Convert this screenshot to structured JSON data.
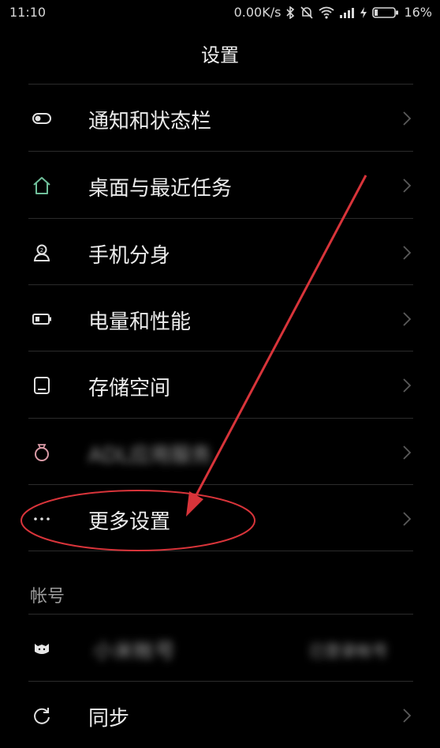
{
  "status_bar": {
    "time": "11:10",
    "speed": "0.00K/s",
    "battery": "16%"
  },
  "header": {
    "title": "设置"
  },
  "items": [
    {
      "label": "通知和状态栏",
      "icon": "toggle-icon"
    },
    {
      "label": "桌面与最近任务",
      "icon": "home-icon"
    },
    {
      "label": "手机分身",
      "icon": "dual-user-icon"
    },
    {
      "label": "电量和性能",
      "icon": "battery-icon"
    },
    {
      "label": "存储空间",
      "icon": "storage-icon"
    },
    {
      "label": "ADL应用服务",
      "icon": "ring-icon"
    },
    {
      "label": "更多设置",
      "icon": "more-dots-icon"
    }
  ],
  "account_section": {
    "title": "帐号",
    "items": [
      {
        "label": "小米帐号",
        "value": "已登录帐号",
        "icon": "mi-icon"
      },
      {
        "label": "同步",
        "icon": "sync-icon"
      }
    ]
  },
  "colors": {
    "background": "#000000",
    "text": "#ececec",
    "annotation": "#d8343a"
  }
}
